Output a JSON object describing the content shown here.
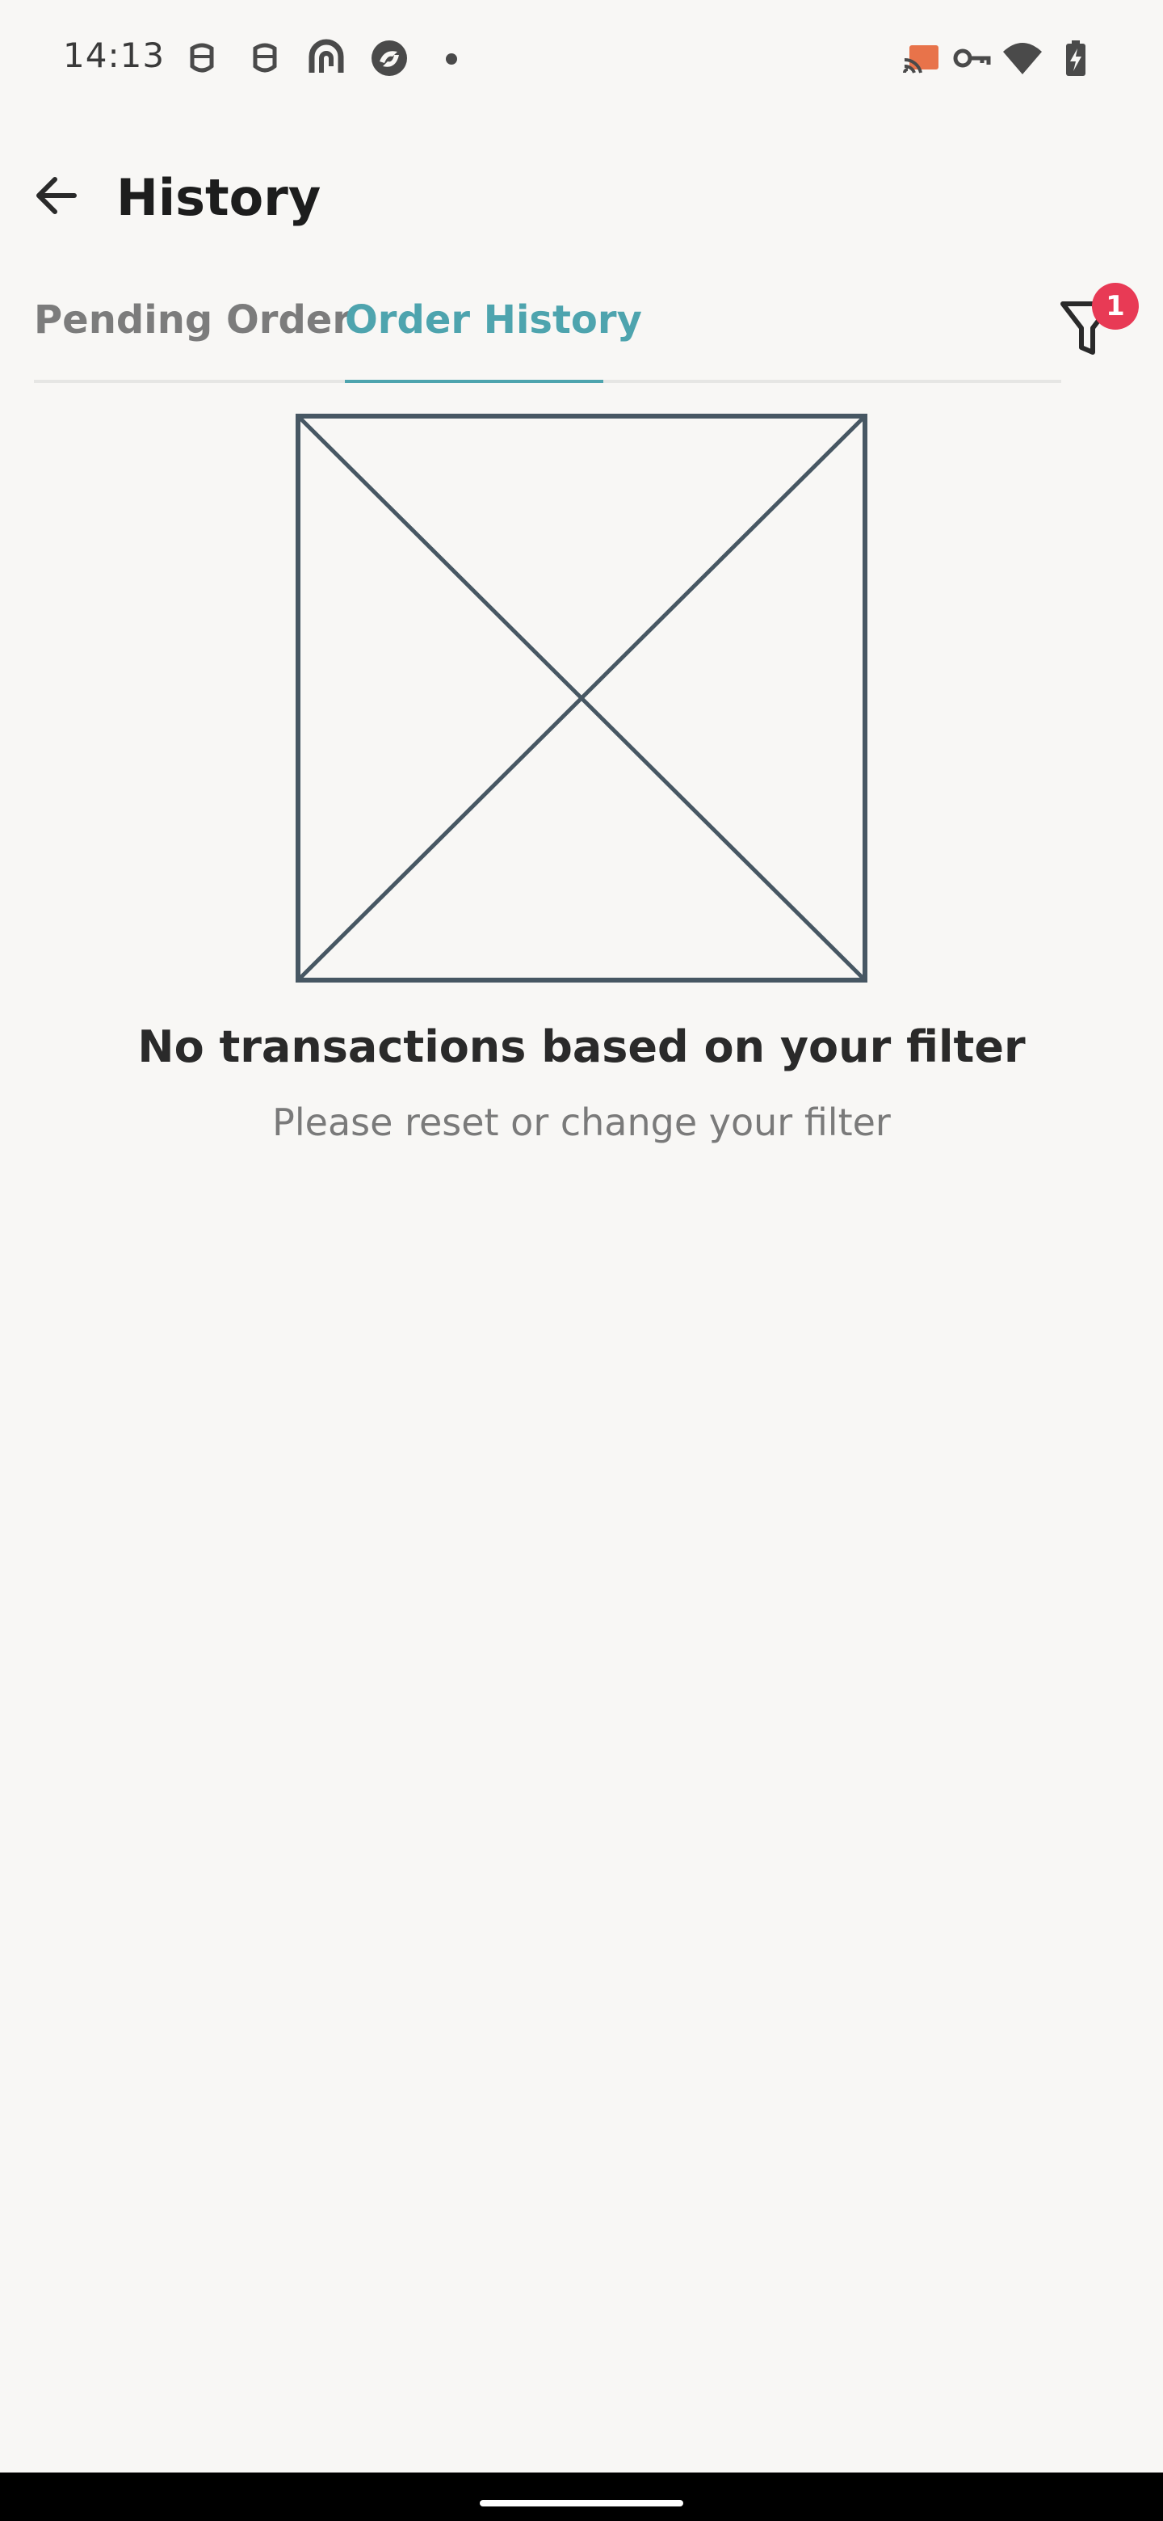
{
  "status_bar": {
    "time": "14:13",
    "left_icons": [
      "notification-icon",
      "notification-icon",
      "app-icon",
      "app-icon"
    ],
    "right_icons": [
      "cast-icon",
      "vpn-key-icon",
      "wifi-icon",
      "battery-charging-icon"
    ]
  },
  "app_bar": {
    "title": "History",
    "back_icon": "arrow-left-icon"
  },
  "tabs": [
    {
      "label": "Pending Order",
      "active": false
    },
    {
      "label": "Order History",
      "active": true
    }
  ],
  "filter": {
    "icon": "filter-icon",
    "badge_count": "1"
  },
  "empty_state": {
    "image": "placeholder-image",
    "title": "No transactions based on your filter",
    "subtitle": "Please reset or change your filter"
  },
  "colors": {
    "accent": "#4ea4ae",
    "badge": "#e83a55",
    "background": "#f8f7f5"
  }
}
